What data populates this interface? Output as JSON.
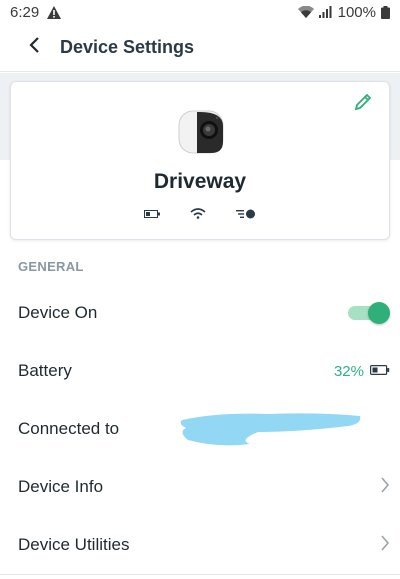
{
  "status_bar": {
    "time": "6:29",
    "battery_percent": "100%",
    "icons": [
      "warning-icon",
      "wifi-icon",
      "signal-icon",
      "battery-icon"
    ]
  },
  "header": {
    "title": "Device Settings",
    "back_icon": "back-arrow-icon"
  },
  "device": {
    "name": "Driveway",
    "edit_icon": "pencil-icon",
    "status_icons": [
      "battery-icon",
      "wifi-icon",
      "motion-sensor-icon"
    ]
  },
  "general": {
    "section_title": "GENERAL",
    "device_on": {
      "label": "Device On",
      "enabled": true
    },
    "battery": {
      "label": "Battery",
      "value": "32%"
    },
    "connected": {
      "label": "Connected to",
      "value_redacted": true
    },
    "device_info": {
      "label": "Device Info"
    },
    "device_utilities": {
      "label": "Device Utilities"
    }
  },
  "colors": {
    "accent": "#2fb07a",
    "toggle_track": "#a8e0c5",
    "section_text": "#8a96a0",
    "band": "#eef1f4",
    "redaction": "#7fd0f2"
  }
}
